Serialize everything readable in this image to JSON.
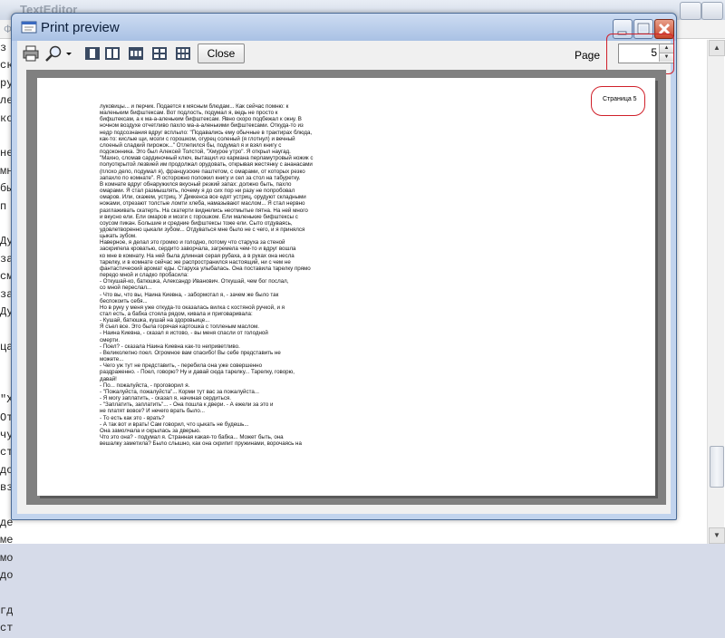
{
  "background_window": {
    "title": "TextEditor",
    "menu_first_item": "Фа",
    "text_fragments": [
      "з",
      "ск",
      "ру",
      "ле",
      "ко",
      "",
      "не",
      "мн",
      "бы",
      "п",
      "",
      "Ду",
      "за",
      "см",
      "за",
      "Ду",
      "",
      "ца",
      "",
      "",
      "\"Х",
      "От",
      "чу",
      "ст",
      "до",
      "вз",
      "",
      "де",
      "ме",
      "мо",
      "до",
      "",
      "гд",
      "ст"
    ]
  },
  "print_preview": {
    "title": "Print preview",
    "close_label": "Close",
    "page_label": "Page",
    "page_value": "5",
    "page_header": "Страница 5",
    "page_lines": [
      "луковицы... и перчик. Подается к мясным блюдам... Как сейчас помню: к",
      "маленьким бифштексам. Вот подлость, подумал я, ведь не просто к",
      "бифштексам, а к ма-а-аленьким бифштексам. Явно скоро подбежал к окну. В",
      "ночном воздухе отчетливо пахло ма-а-аленькими бифштексами. Откуда-то из",
      "недр подсознания вдруг всплыло: \"Подавались ему обычные в трактирах блюда,",
      "как-то: кислые щи, мозги с горошком, огурец соленый (я глотнул) и вечный",
      "слоеный сладкий пирожок...\" Отлепился бы, подумал я и взял книгу с",
      "подоконника. Это был Алексей Толстой, \"Хмурое утро\". Я открыл наугад.",
      "\"Махно, сломав сардиночный ключ, вытащил из кармана перламутровый ножик с",
      "полуоткрытой лезвией им продолжал орудовать, открывая жестянку с ананасами",
      "(плохо дело, подумал я), французские паштетом, с омарами, от которых резко",
      "запахло по комнате\". Я осторожно положил книгу и сел за стол на табуретку.",
      "В комнате вдруг обнаружился вкусный резкий запах: должно быть, пахло",
      "омарами. Я стал размышлять, почему я до сих пор ни разу не попробовал",
      "омаров. Или, скажем, устриц. У Диккенса все едят устриц, орудуют складными",
      "ножами, отрезают толстые ломти хлеба, намазывают маслом... Я стал нервно",
      "разглаживать скатерть. На скатерти виднелись неотмытые пятна. На ней много",
      "и вкусно ели. Ели омаров и мозги с горошком. Ели маленькие бифштексы с",
      "соусом пикан. Большие и средние бифштексы тоже ели. Сыто отдуваясь,",
      "удовлетворенно цыкали зубом... Отдуваться мне было не с чего, и я принялся",
      "цыкать зубом.",
      "    Наверное, я делал это громко и голодно, потому что старуха за стеной",
      "заскрипела кроватью, сердито заворчала, загремела чем-то и вдруг вошла",
      "ко мне в комнату. На ней была длинная серая рубаха, а в руках она несла",
      "тарелку, и в комнате сейчас же распространился настоящий, ни с чем не",
      "фантастический аромат еды. Старуха улыбалась. Она поставила тарелку прямо",
      "передо мной и сладко пробасила:",
      "    - Откушай-ко, батюшка, Александр Иванович. Откушай, чем бог послал,",
      "со мной переслал...",
      "    - Что вы, что вы, Наина Киевна, - забормотал я, - зачем же было так",
      "беспокоить себя...",
      "    Но в руку у меня уже откуда-то оказалась вилка с костяной ручкой, и я",
      "стал есть, а бабка стояла рядом, кивала и приговаривала:",
      "    - Кушай, батюшка, кушай на здоровьице...",
      "    Я съел все. Это была горячая картошка с топленым маслом.",
      "    - Наина Киевна, - сказал я истово, - вы меня спасли от голодной",
      "смерти.",
      "    - Поел? - сказала Наина Киевна как-то неприветливо.",
      "    - Великолепно поел. Огромное вам спасибо! Вы себе представить не",
      "можете...",
      "    - Чего уж тут не представить, - перебила она уже совершенно",
      "раздраженно. - Поел, говорю? Ну и давай сюда тарелку... Тарелку, говорю,",
      "давай!",
      "    - По... пожалуйста, - проговорил я.",
      "    - \"Пожалуйста, пожалуйста\"... Корми тут вас за пожалуйста...",
      "    - Я могу заплатить, - сказал я, начиная сердиться.",
      "    - \"Заплатить, заплатить\"... - Она пошла к двери. - А ежели за это и",
      "не платят вовсе? И нечего врать было...",
      "    - То есть как это - врать?",
      "    - А так вот и врать! Сам говорил, что цыкать не будешь...",
      "    Она замолчала и скрылась за дверью.",
      "    Что это она? - подумал я. Странная какая-то бабка... Может быть, она",
      "вешалку заметила? Было слышно, как она скрипит пружинами, ворочаясь на"
    ]
  },
  "colors": {
    "highlight": "#d0202a",
    "preview_background": "#808080",
    "dialog_frame": "#c2d4ee"
  },
  "icons": [
    "printer-icon",
    "zoom-icon",
    "dropdown-arrow-icon",
    "one-page-icon",
    "two-pages-icon",
    "three-pages-icon",
    "four-pages-icon",
    "six-pages-icon",
    "minimize-icon",
    "maximize-icon",
    "close-icon"
  ]
}
